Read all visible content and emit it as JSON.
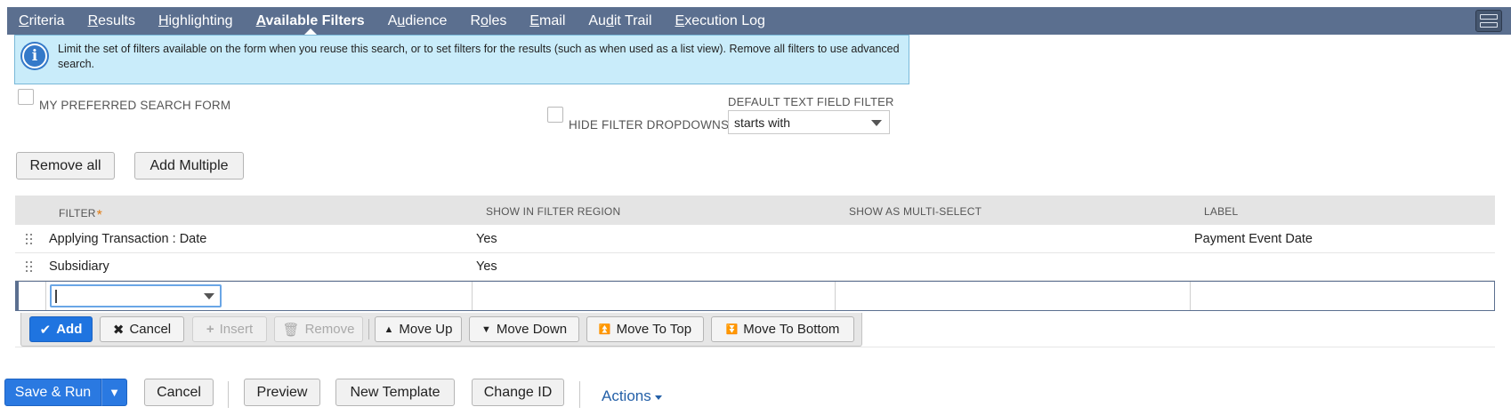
{
  "tabs": [
    {
      "pre": "",
      "u": "C",
      "post": "riteria",
      "active": false
    },
    {
      "pre": "",
      "u": "R",
      "post": "esults",
      "active": false
    },
    {
      "pre": "",
      "u": "H",
      "post": "ighlighting",
      "active": false
    },
    {
      "pre": "",
      "u": "A",
      "post": "vailable Filters",
      "active": true
    },
    {
      "pre": "A",
      "u": "u",
      "post": "dience",
      "active": false
    },
    {
      "pre": "R",
      "u": "o",
      "post": "les",
      "active": false
    },
    {
      "pre": "",
      "u": "E",
      "post": "mail",
      "active": false
    },
    {
      "pre": "Au",
      "u": "d",
      "post": "it Trail",
      "active": false
    },
    {
      "pre": "",
      "u": "E",
      "post": "xecution Log",
      "active": false
    }
  ],
  "info": {
    "icon": "info-icon",
    "text": "Limit the set of filters available on the form when you reuse this search, or to set filters for the results (such as when used as a list view). Remove all filters to use advanced search."
  },
  "options": {
    "preferred_label": "MY PREFERRED SEARCH FORM",
    "hide_dropdowns_label": "HIDE FILTER DROPDOWNS",
    "default_filter_label": "DEFAULT TEXT FIELD FILTER",
    "default_filter_value": "starts with"
  },
  "buttons": {
    "remove_all": "Remove all",
    "add_multiple": "Add Multiple"
  },
  "table": {
    "headers": {
      "filter": "FILTER",
      "required_mark": "*",
      "show_region": "SHOW IN FILTER REGION",
      "multi_select": "SHOW AS MULTI-SELECT",
      "label": "LABEL"
    },
    "rows": [
      {
        "filter": "Applying Transaction : Date",
        "show_region": "Yes",
        "multi_select": "",
        "label": "Payment Event Date"
      },
      {
        "filter": "Subsidiary",
        "show_region": "Yes",
        "multi_select": "",
        "label": ""
      }
    ]
  },
  "row_toolbar": {
    "add": "Add",
    "cancel": "Cancel",
    "insert": "Insert",
    "remove": "Remove",
    "move_up": "Move Up",
    "move_down": "Move Down",
    "move_to_top": "Move To Top",
    "move_to_bottom": "Move To Bottom"
  },
  "footer": {
    "save_run": "Save & Run",
    "split_arrow": "▼",
    "cancel": "Cancel",
    "preview": "Preview",
    "new_template": "New Template",
    "change_id": "Change ID",
    "actions": "Actions"
  }
}
